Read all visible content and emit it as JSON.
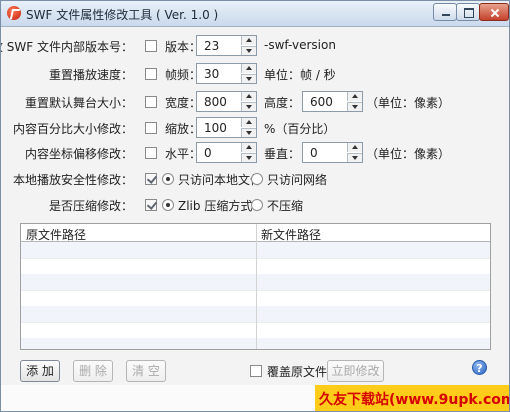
{
  "window": {
    "title": "SWF 文件属性修改工具 ( Ver. 1.0 )"
  },
  "form": {
    "version": {
      "label": "修改 SWF 文件内部版本号：",
      "check_label": "版本：",
      "value": "23",
      "suffix": "-swf-version"
    },
    "frame_rate": {
      "label": "重置播放速度：",
      "check_label": "帧频：",
      "value": "30",
      "suffix": "单位：帧 / 秒"
    },
    "stage_size": {
      "label": "重置默认舞台大小：",
      "check_label": "宽度：",
      "width": "800",
      "height_label": "高度：",
      "height": "600",
      "unit": "（单位：像素）"
    },
    "scale": {
      "label": "内容百分比大小修改：",
      "check_label": "缩放：",
      "value": "100",
      "suffix": "%（百分比）"
    },
    "offset": {
      "label": "内容坐标偏移修改：",
      "check_label": "水平：",
      "horizontal": "0",
      "vertical_label": "垂直：",
      "vertical": "0",
      "unit": "（单位：像素）"
    },
    "security": {
      "label": "本地播放安全性修改：",
      "option1": "只访问本地文件",
      "option2": "只访问网络"
    },
    "compress": {
      "label": "是否压缩修改：",
      "option1": "Zlib 压缩方式",
      "option2": "不压缩"
    }
  },
  "table": {
    "col1": "原文件路径",
    "col2": "新文件路径"
  },
  "buttons": {
    "add": "添 加",
    "delete": "删 除",
    "clear": "清 空",
    "overwrite": "覆盖原文件",
    "modify": "立即修改"
  },
  "icons": {
    "help": "?"
  },
  "watermark": {
    "text": "久友下载站(www.9upk.com)"
  }
}
